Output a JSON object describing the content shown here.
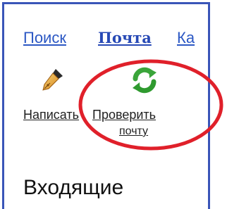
{
  "nav": {
    "search_label": "Поиск",
    "mail_label": "Почта",
    "more_label": "Ка"
  },
  "actions": {
    "write_label": "Написать",
    "check_label_line1": "Проверить",
    "check_label_line2": "почту"
  },
  "folder": {
    "title": "Входящие"
  },
  "icons": {
    "write": "pen-icon",
    "check": "refresh-icon"
  },
  "colors": {
    "frame_border": "#3a55b8",
    "link": "#2c58c4",
    "highlight": "#e0202a",
    "refresh_green": "#3aa53a"
  }
}
